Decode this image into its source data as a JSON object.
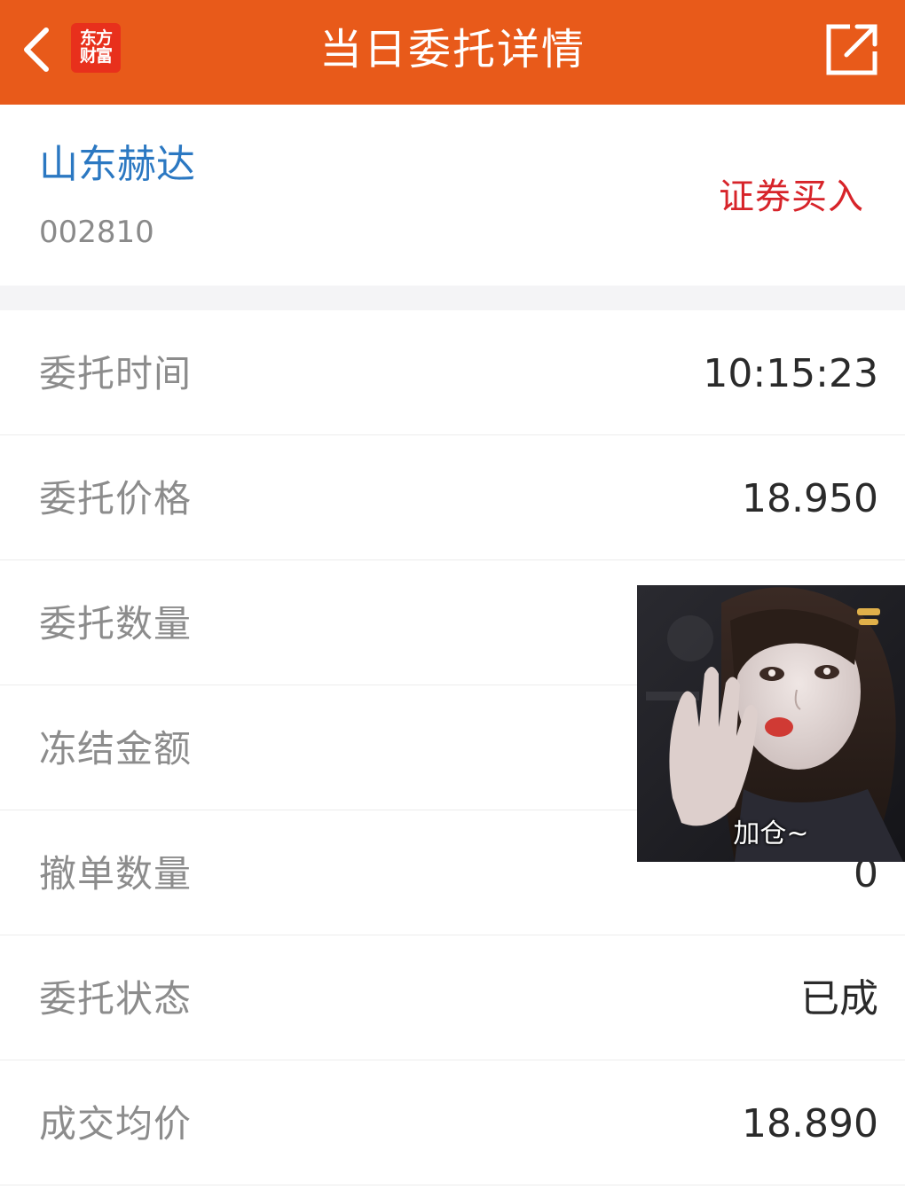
{
  "header": {
    "title": "当日委托详情",
    "logo_line1": "东方",
    "logo_line2": "财富",
    "back_icon": "chevron-left-icon",
    "share_icon": "share-external-icon",
    "background_color": "#e85a1a"
  },
  "stock": {
    "name": "山东赫达",
    "code": "002810",
    "trade_type": "证券买入",
    "name_color": "#2b78c2",
    "trade_type_color": "#d7242a"
  },
  "details": [
    {
      "label": "委托时间",
      "value": "10:15:23"
    },
    {
      "label": "委托价格",
      "value": "18.950"
    },
    {
      "label": "委托数量",
      "value": ""
    },
    {
      "label": "冻结金额",
      "value": ""
    },
    {
      "label": "撤单数量",
      "value": "0"
    },
    {
      "label": "委托状态",
      "value": "已成"
    },
    {
      "label": "成交均价",
      "value": "18.890"
    }
  ],
  "sticker": {
    "caption": "加仓~"
  }
}
